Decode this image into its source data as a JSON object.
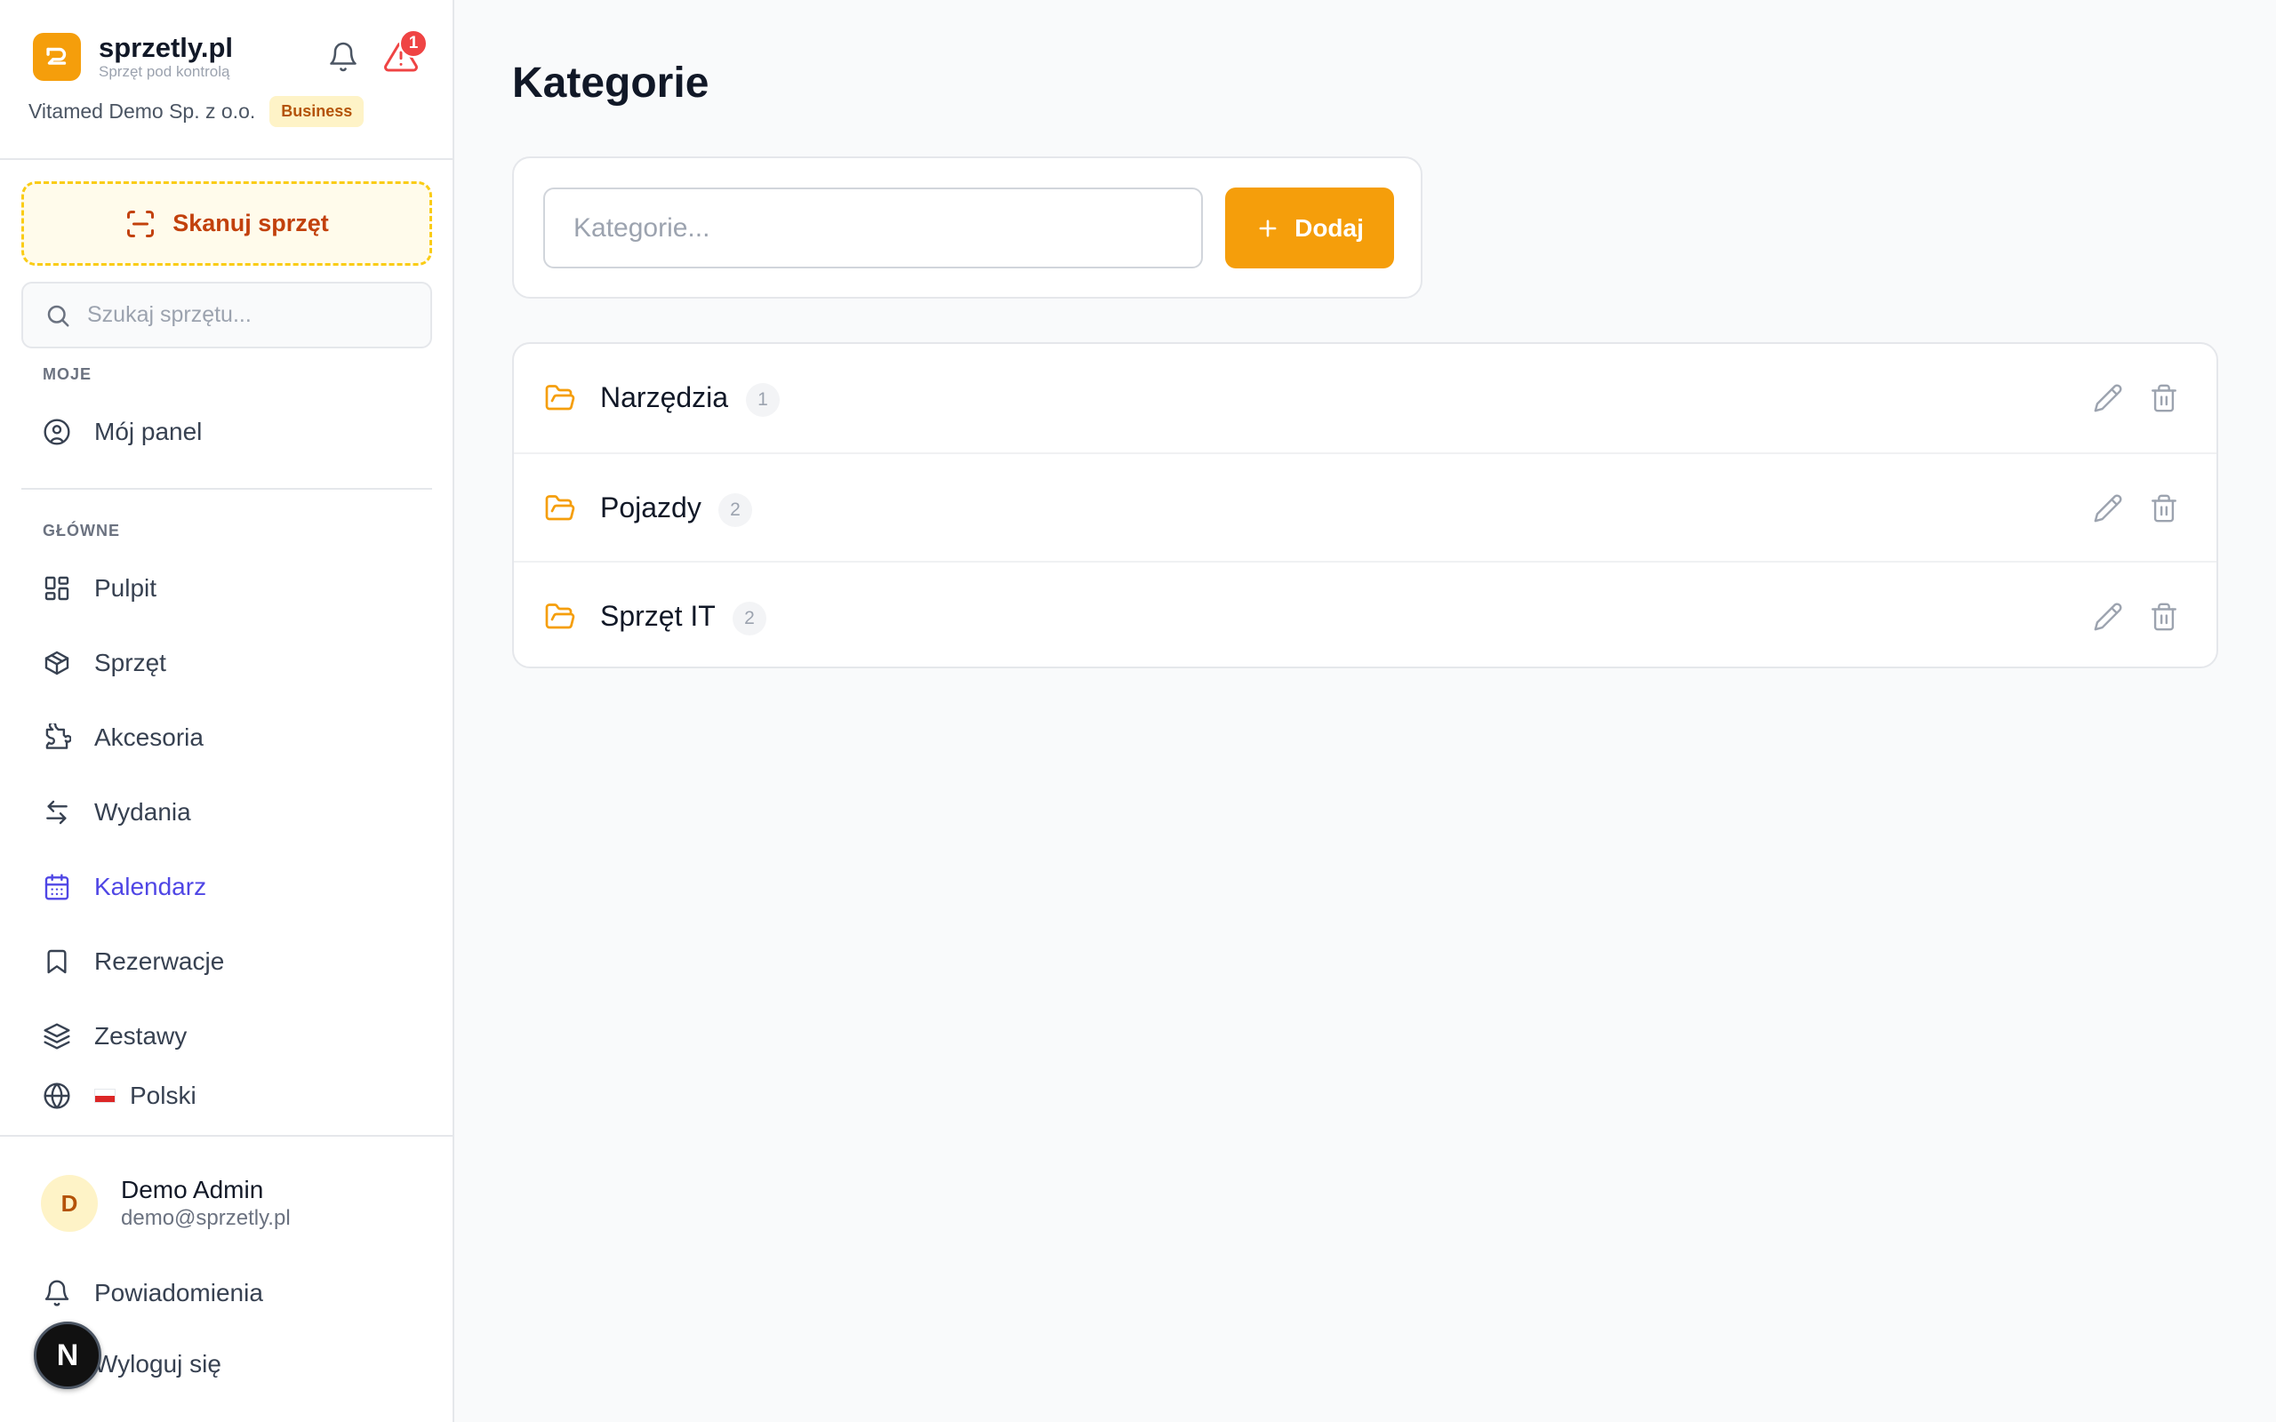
{
  "brand": {
    "name": "sprzetly.pl",
    "tagline": "Sprzęt pod kontrolą",
    "alert_count": "1"
  },
  "org": {
    "name": "Vitamed Demo Sp. z o.o.",
    "plan": "Business"
  },
  "sidebar": {
    "scan_label": "Skanuj sprzęt",
    "search_placeholder": "Szukaj sprzętu...",
    "section_mine": "MOJE",
    "mine_items": [
      {
        "label": "Mój panel",
        "icon": "user-circle-icon"
      }
    ],
    "section_main": "GŁÓWNE",
    "main_items": [
      {
        "label": "Pulpit",
        "icon": "dashboard-icon"
      },
      {
        "label": "Sprzęt",
        "icon": "package-icon"
      },
      {
        "label": "Akcesoria",
        "icon": "puzzle-icon"
      },
      {
        "label": "Wydania",
        "icon": "arrows-swap-icon"
      },
      {
        "label": "Kalendarz",
        "icon": "calendar-icon",
        "active": true
      },
      {
        "label": "Rezerwacje",
        "icon": "bookmark-icon"
      },
      {
        "label": "Zestawy",
        "icon": "layers-icon"
      }
    ],
    "language": "Polski",
    "user": {
      "initial": "D",
      "name": "Demo Admin",
      "email": "demo@sprzetly.pl"
    },
    "notifications_label": "Powiadomienia",
    "logout_label": "Wyloguj się",
    "devtools_letter": "N"
  },
  "main": {
    "title": "Kategorie",
    "input_placeholder": "Kategorie...",
    "add_label": "Dodaj",
    "categories": [
      {
        "name": "Narzędzia",
        "count": "1"
      },
      {
        "name": "Pojazdy",
        "count": "2"
      },
      {
        "name": "Sprzęt IT",
        "count": "2"
      }
    ]
  },
  "colors": {
    "accent": "#f59e0b",
    "active_nav": "#4f46e5",
    "alert": "#ef4444",
    "plan_badge_bg": "#fef3c7",
    "plan_badge_text": "#b45309"
  }
}
